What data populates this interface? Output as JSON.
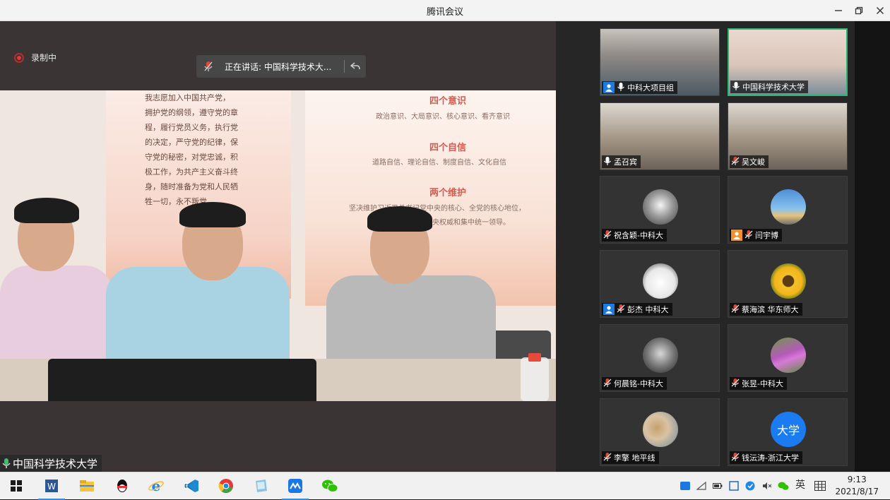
{
  "window": {
    "title": "腾讯会议"
  },
  "recording": {
    "label": "录制中"
  },
  "speaking": {
    "text": "正在讲话: 中国科学技术大..."
  },
  "main_video": {
    "label": "中国科学技术大学"
  },
  "poster": {
    "oath": [
      "我志愿加入中国共产党，",
      "拥护党的纲领，遵守党的章",
      "程，履行党员义务，执行党",
      "的决定，严守党的纪律，保",
      "守党的秘密，对党忠诚，积",
      "极工作，为共产主义奋斗终",
      "身，随时准备为党和人民牺",
      "牲一切，永不叛党。"
    ],
    "heading1": "四个意识",
    "line1": "政治意识、大局意识、核心意识、看齐意识",
    "heading2": "四个自信",
    "line2": "道路自信、理论自信、制度自信、文化自信",
    "heading3": "两个维护",
    "line3a": "坚决维护习近平总书记党中央的核心、全党的核心地位，",
    "line3b": "坚决维护党中央权威和集中统一领导。"
  },
  "participants": [
    {
      "name": "中科大项目组",
      "host": true,
      "mic": "on",
      "active": false
    },
    {
      "name": "中国科学技术大学",
      "host": false,
      "mic": "on",
      "active": true
    },
    {
      "name": "孟召宾",
      "host": false,
      "mic": "on",
      "active": false
    },
    {
      "name": "吴文峻",
      "host": false,
      "mic": "off",
      "active": false
    },
    {
      "name": "祝含颖-中科大",
      "host": false,
      "mic": "off",
      "active": false
    },
    {
      "name": "闫宇博",
      "host": "orange",
      "mic": "off",
      "active": false
    },
    {
      "name": "彭杰 中科大",
      "host": true,
      "mic": "off",
      "active": false
    },
    {
      "name": "蔡海滨 华东师大",
      "host": false,
      "mic": "off",
      "active": false
    },
    {
      "name": "何晨铭-中科大",
      "host": false,
      "mic": "off",
      "active": false
    },
    {
      "name": "张昱-中科大",
      "host": false,
      "mic": "off",
      "active": false
    },
    {
      "name": "李擎 地平线",
      "host": false,
      "mic": "off",
      "active": false
    },
    {
      "name": "钱沄涛-浙江大学",
      "host": false,
      "mic": "off",
      "active": false
    }
  ],
  "avatar_text": {
    "qian": "大学"
  },
  "taskbar": {
    "apps": [
      "start-icon",
      "word-icon",
      "file-explorer-icon",
      "qq-icon",
      "ie-icon",
      "vscode-icon",
      "chrome-icon",
      "notepad-icon",
      "tencent-meeting-icon",
      "wechat-icon"
    ],
    "ime": "英",
    "time": "9:13",
    "date": "2021/8/17"
  },
  "colors": {
    "accent_green": "#2bb673",
    "host_blue": "#1f7ae0",
    "muted_red": "#e0453a"
  }
}
